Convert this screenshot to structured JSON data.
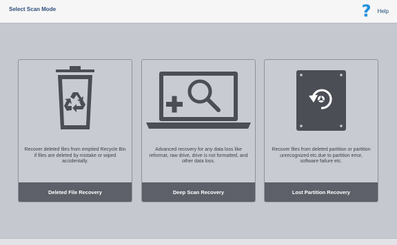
{
  "header": {
    "title": "Select Scan Mode",
    "help_icon": "question-mark-icon",
    "help_label": "Help"
  },
  "colors": {
    "background": "#c5c9cf",
    "header_bg": "#f6f6f6",
    "card_bg": "#c8ccd2",
    "card_bar": "#5d6068",
    "icon_dark": "#4b4e55",
    "help_blue": "#1f8fde"
  },
  "cards": [
    {
      "icon": "recycle-bin-icon",
      "description": "Recover deleted files from emptied Recycle Bin if files are deleted by mistake or wiped accidentally.",
      "label": "Deleted File Recovery"
    },
    {
      "icon": "laptop-search-icon",
      "description": "Advanced recovery for any data loss like reformat, raw drive, drive is not formatted, and other data loss.",
      "label": "Deep Scan Recovery"
    },
    {
      "icon": "hard-drive-recovery-icon",
      "description": "Recover files from deleted partition or partition unrecognized etc.due to partition error, software failure etc.",
      "label": "Lost Partition Recovery"
    }
  ]
}
